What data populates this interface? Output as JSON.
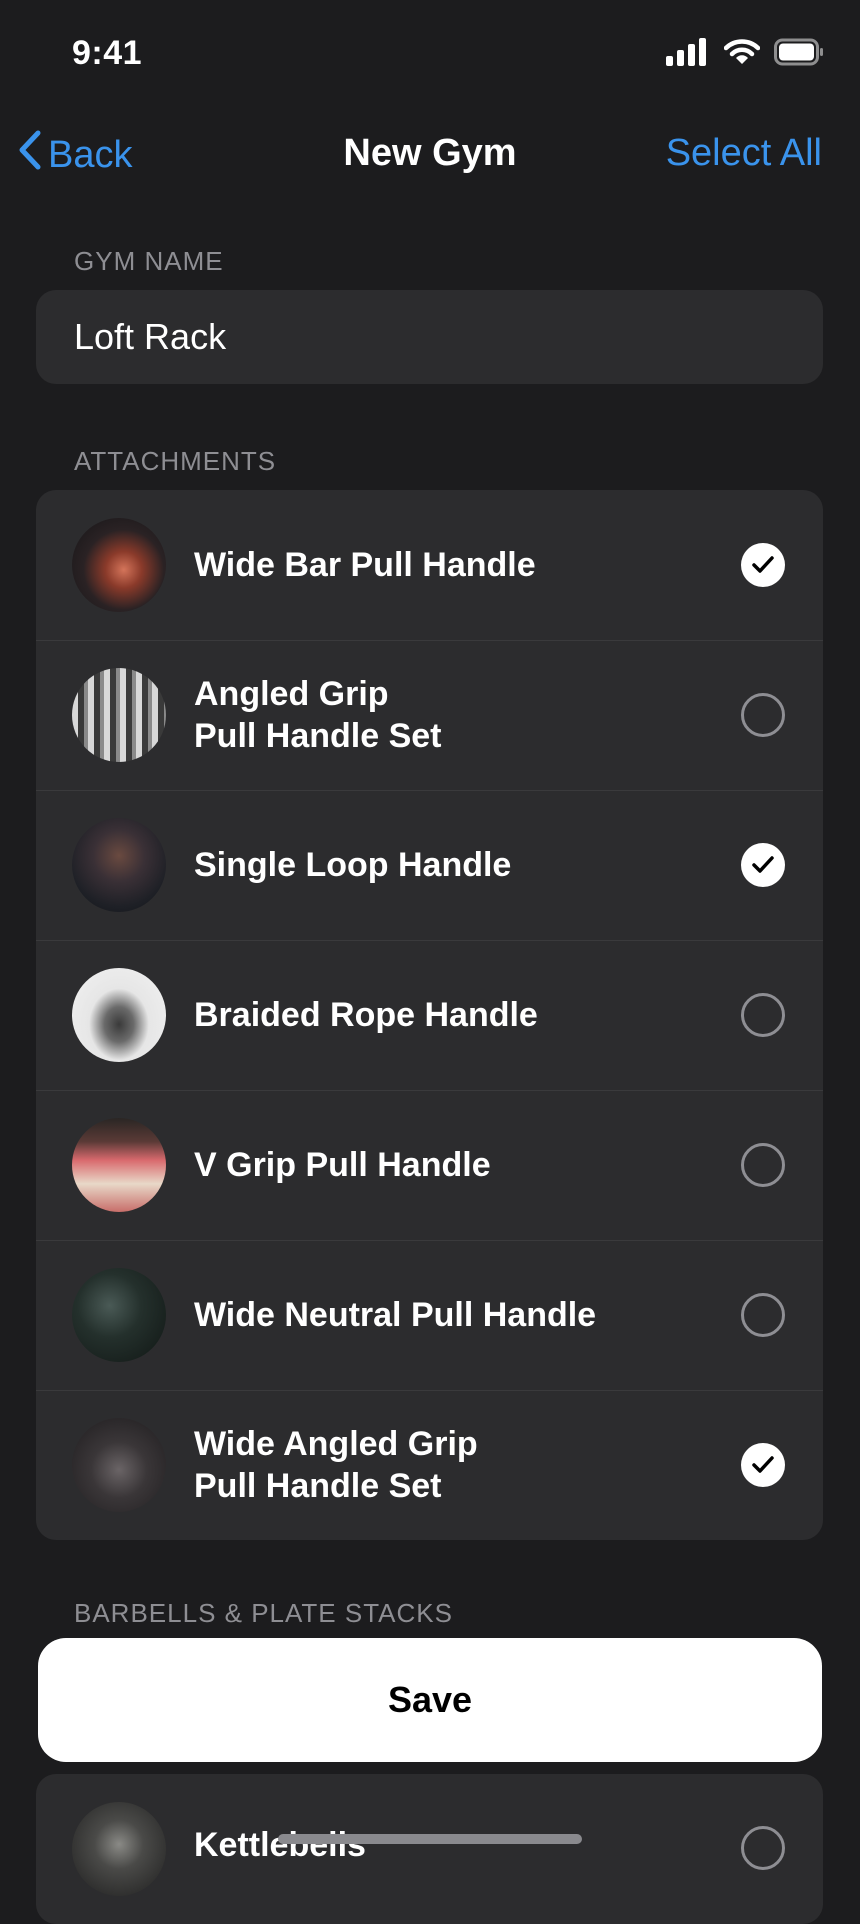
{
  "status": {
    "time": "9:41",
    "icons": [
      "signal-icon",
      "wifi-icon",
      "battery-icon"
    ]
  },
  "nav": {
    "back_label": "Back",
    "title": "New Gym",
    "right_label": "Select All",
    "accent": "#3a93ec"
  },
  "gym_name": {
    "section_label": "GYM NAME",
    "value": "Loft Rack"
  },
  "attachments": {
    "section_label": "ATTACHMENTS",
    "items": [
      {
        "label": "Wide Bar Pull Handle",
        "selected": true
      },
      {
        "label": "Angled Grip\nPull Handle Set",
        "selected": false
      },
      {
        "label": "Single Loop Handle",
        "selected": true
      },
      {
        "label": "Braided Rope Handle",
        "selected": false
      },
      {
        "label": "V Grip Pull Handle",
        "selected": false
      },
      {
        "label": "Wide Neutral Pull Handle",
        "selected": false
      },
      {
        "label": "Wide Angled Grip\nPull Handle Set",
        "selected": true
      }
    ]
  },
  "barbells": {
    "section_label": "BARBELLS & PLATE STACKS",
    "items": [
      {
        "label": "Kettlebells",
        "selected": false
      }
    ]
  },
  "save_label": "Save"
}
